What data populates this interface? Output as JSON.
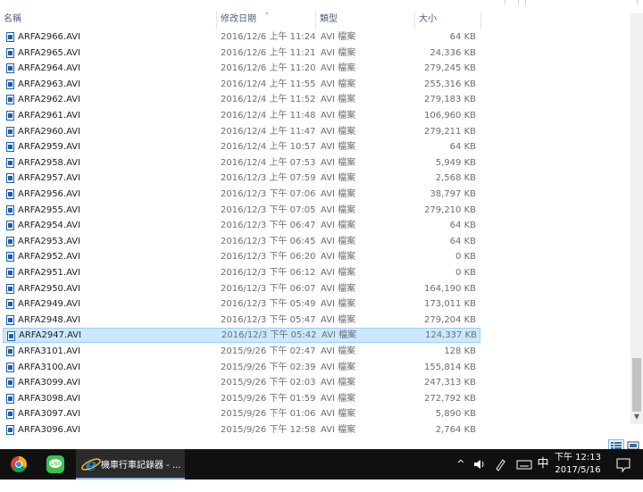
{
  "columns": {
    "name": "名稱",
    "date": "修改日期",
    "type": "類型",
    "size": "大小"
  },
  "files": [
    {
      "name": "ARFA2966.AVI",
      "date": "2016/12/6 上午 11:24",
      "type": "AVI 檔案",
      "size": "64 KB"
    },
    {
      "name": "ARFA2965.AVI",
      "date": "2016/12/6 上午 11:21",
      "type": "AVI 檔案",
      "size": "24,336 KB"
    },
    {
      "name": "ARFA2964.AVI",
      "date": "2016/12/6 上午 11:20",
      "type": "AVI 檔案",
      "size": "279,245 KB"
    },
    {
      "name": "ARFA2963.AVI",
      "date": "2016/12/4 上午 11:55",
      "type": "AVI 檔案",
      "size": "255,316 KB"
    },
    {
      "name": "ARFA2962.AVI",
      "date": "2016/12/4 上午 11:52",
      "type": "AVI 檔案",
      "size": "279,183 KB"
    },
    {
      "name": "ARFA2961.AVI",
      "date": "2016/12/4 上午 11:48",
      "type": "AVI 檔案",
      "size": "106,960 KB"
    },
    {
      "name": "ARFA2960.AVI",
      "date": "2016/12/4 上午 11:47",
      "type": "AVI 檔案",
      "size": "279,211 KB"
    },
    {
      "name": "ARFA2959.AVI",
      "date": "2016/12/4 上午 10:57",
      "type": "AVI 檔案",
      "size": "64 KB"
    },
    {
      "name": "ARFA2958.AVI",
      "date": "2016/12/4 上午 07:53",
      "type": "AVI 檔案",
      "size": "5,949 KB"
    },
    {
      "name": "ARFA2957.AVI",
      "date": "2016/12/3 上午 07:59",
      "type": "AVI 檔案",
      "size": "2,568 KB"
    },
    {
      "name": "ARFA2956.AVI",
      "date": "2016/12/3 下午 07:06",
      "type": "AVI 檔案",
      "size": "38,797 KB"
    },
    {
      "name": "ARFA2955.AVI",
      "date": "2016/12/3 下午 07:05",
      "type": "AVI 檔案",
      "size": "279,210 KB"
    },
    {
      "name": "ARFA2954.AVI",
      "date": "2016/12/3 下午 06:47",
      "type": "AVI 檔案",
      "size": "64 KB"
    },
    {
      "name": "ARFA2953.AVI",
      "date": "2016/12/3 下午 06:45",
      "type": "AVI 檔案",
      "size": "64 KB"
    },
    {
      "name": "ARFA2952.AVI",
      "date": "2016/12/3 下午 06:20",
      "type": "AVI 檔案",
      "size": "0 KB"
    },
    {
      "name": "ARFA2951.AVI",
      "date": "2016/12/3 下午 06:12",
      "type": "AVI 檔案",
      "size": "0 KB"
    },
    {
      "name": "ARFA2950.AVI",
      "date": "2016/12/3 下午 06:07",
      "type": "AVI 檔案",
      "size": "164,190 KB"
    },
    {
      "name": "ARFA2949.AVI",
      "date": "2016/12/3 下午 05:49",
      "type": "AVI 檔案",
      "size": "173,011 KB"
    },
    {
      "name": "ARFA2948.AVI",
      "date": "2016/12/3 下午 05:47",
      "type": "AVI 檔案",
      "size": "279,204 KB"
    },
    {
      "name": "ARFA2947.AVI",
      "date": "2016/12/3 下午 05:42",
      "type": "AVI 檔案",
      "size": "124,337 KB",
      "selected": true
    },
    {
      "name": "ARFA3101.AVI",
      "date": "2015/9/26 下午 02:47",
      "type": "AVI 檔案",
      "size": "128 KB"
    },
    {
      "name": "ARFA3100.AVI",
      "date": "2015/9/26 下午 02:39",
      "type": "AVI 檔案",
      "size": "155,814 KB"
    },
    {
      "name": "ARFA3099.AVI",
      "date": "2015/9/26 下午 02:03",
      "type": "AVI 檔案",
      "size": "247,313 KB"
    },
    {
      "name": "ARFA3098.AVI",
      "date": "2015/9/26 下午 01:59",
      "type": "AVI 檔案",
      "size": "272,792 KB"
    },
    {
      "name": "ARFA3097.AVI",
      "date": "2015/9/26 下午 01:06",
      "type": "AVI 檔案",
      "size": "5,890 KB"
    },
    {
      "name": "ARFA3096.AVI",
      "date": "2015/9/26 下午 12:58",
      "type": "AVI 檔案",
      "size": "2,764 KB"
    }
  ],
  "icons": {
    "file": "video-file-icon",
    "sort": "sort-chevron-icon"
  },
  "taskbar": {
    "apps": [
      {
        "icon": "chrome-icon"
      },
      {
        "icon": "line-icon",
        "text": "LINE"
      },
      {
        "icon": "ie-icon",
        "label": "機車行車記錄器 - ..."
      }
    ],
    "tray": {
      "chevron": "^",
      "ime": "中",
      "time": "下午 12:13",
      "date": "2017/5/16"
    }
  },
  "colors": {
    "selection_bg": "#cce8ff",
    "selection_border": "#99d1ff",
    "taskbar_bg": "#101010",
    "accent": "#1e78d2"
  }
}
